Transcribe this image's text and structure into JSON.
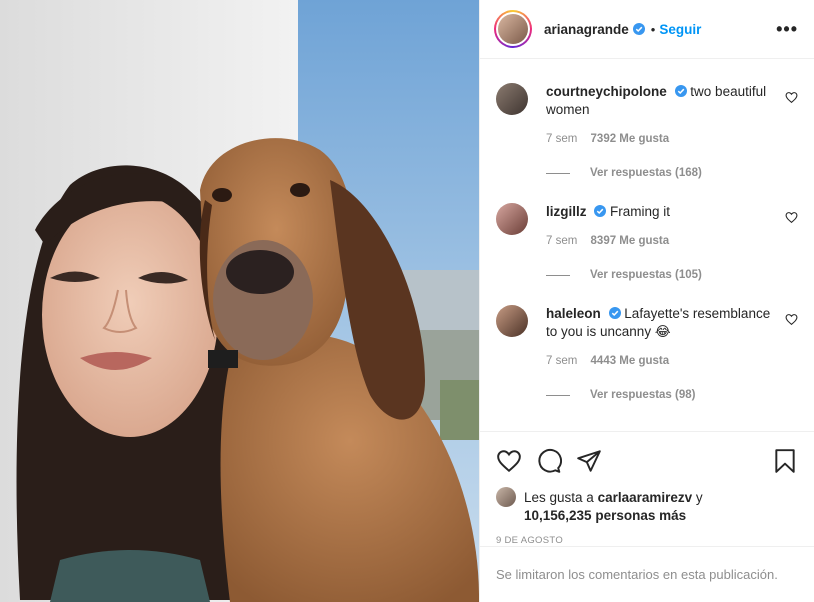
{
  "post": {
    "author": "arianagrande",
    "follow_label": "Seguir",
    "dot": "•",
    "more": "•••"
  },
  "comments": [
    {
      "user": "courtneychipolone",
      "text": "two beautiful women",
      "age": "7 sem",
      "likes": "7392 Me gusta",
      "replies": "Ver respuestas (168)"
    },
    {
      "user": "lizgillz",
      "text": "Framing it",
      "age": "7 sem",
      "likes": "8397 Me gusta",
      "replies": "Ver respuestas (105)"
    },
    {
      "user": "haleleon",
      "text": "Lafayette's resemblance to you is uncanny 😂",
      "age": "7 sem",
      "likes": "4443 Me gusta",
      "replies": "Ver respuestas (98)"
    }
  ],
  "likes": {
    "prefix": "Les gusta a",
    "user": "carlaaramirezv",
    "connector": "y",
    "count": "10,156,235 personas más"
  },
  "date": "9 DE AGOSTO",
  "comments_limited": "Se limitaron los comentarios en esta publicación.",
  "colors": {
    "accent": "#0095f6",
    "verified": "#3897f0",
    "muted": "#8e8e8e"
  }
}
